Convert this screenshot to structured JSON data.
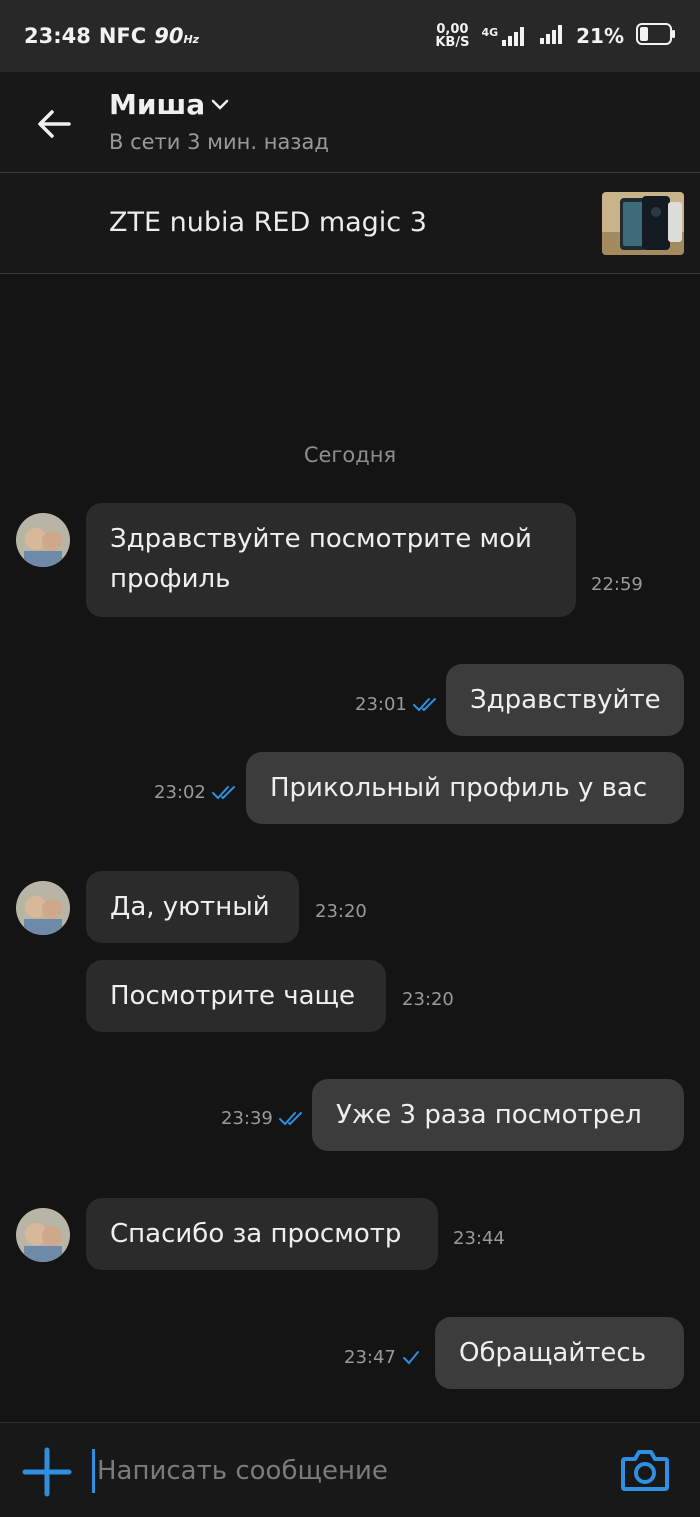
{
  "status_bar": {
    "time": "23:48",
    "nfc": "NFC",
    "refresh": "90",
    "refresh_unit": "Hz",
    "speed_value": "0,00",
    "speed_unit": "KB/S",
    "network": "4G",
    "battery": "21%"
  },
  "header": {
    "contact_name": "Миша",
    "status": "В сети 3 мин. назад"
  },
  "product": {
    "title": "ZTE nubia RED magic 3"
  },
  "chat": {
    "date_separator": "Сегодня",
    "messages": [
      {
        "direction": "in",
        "text": "Здравствуйте посмотрите мой профиль",
        "time": "22:59"
      },
      {
        "direction": "out",
        "text": "Здравствуйте",
        "time": "23:01",
        "read": true
      },
      {
        "direction": "out",
        "text": "Прикольный профиль у вас",
        "time": "23:02",
        "read": true
      },
      {
        "direction": "in",
        "text": "Да, уютный",
        "time": "23:20"
      },
      {
        "direction": "in",
        "text": "Посмотрите чаще",
        "time": "23:20"
      },
      {
        "direction": "out",
        "text": "Уже 3 раза посмотрел",
        "time": "23:39",
        "read": true
      },
      {
        "direction": "in",
        "text": "Спасибо за просмотр",
        "time": "23:44"
      },
      {
        "direction": "out",
        "text": "Обращайтесь",
        "time": "23:47",
        "read": false
      }
    ]
  },
  "composer": {
    "placeholder": "Написать сообщение",
    "value": ""
  },
  "colors": {
    "accent": "#2f8fe0",
    "incoming_bubble": "#2b2b2b",
    "outgoing_bubble": "#3c3c3c",
    "background": "#141414"
  },
  "icons": {
    "back": "arrow-left-icon",
    "dropdown": "chevron-down-icon",
    "attach": "plus-icon",
    "camera": "camera-icon",
    "read_status": "double-check-icon",
    "sent_status": "check-icon"
  }
}
